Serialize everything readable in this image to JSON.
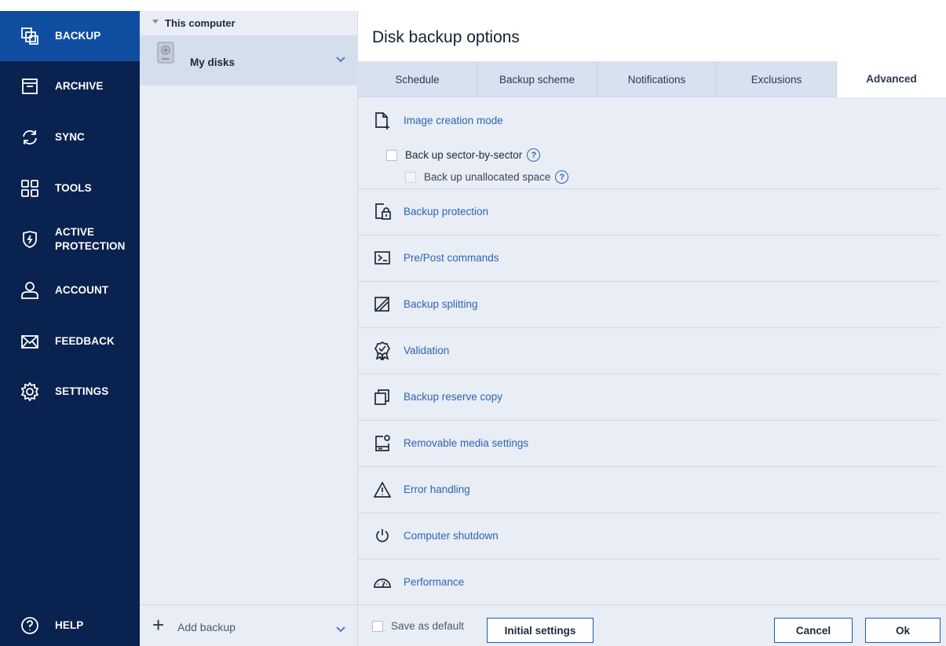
{
  "nav": {
    "items": [
      {
        "label": "BACKUP",
        "icon": "backup-icon"
      },
      {
        "label": "ARCHIVE",
        "icon": "archive-icon"
      },
      {
        "label": "SYNC",
        "icon": "sync-icon"
      },
      {
        "label": "TOOLS",
        "icon": "tools-icon"
      },
      {
        "label": "ACTIVE",
        "label2": "PROTECTION",
        "icon": "shield-icon"
      },
      {
        "label": "ACCOUNT",
        "icon": "account-icon"
      },
      {
        "label": "FEEDBACK",
        "icon": "envelope-icon"
      },
      {
        "label": "SETTINGS",
        "icon": "gear-icon"
      }
    ],
    "help": {
      "label": "HELP",
      "icon": "help-icon"
    }
  },
  "sources": {
    "group_label": "This computer",
    "selected_item": "My disks",
    "add_backup": "Add backup"
  },
  "options": {
    "title": "Disk backup options",
    "tabs": [
      "Schedule",
      "Backup scheme",
      "Notifications",
      "Exclusions",
      "Advanced"
    ],
    "active_tab": "Advanced",
    "sections": [
      {
        "label": "Image creation mode",
        "icon": "image-creation-icon",
        "expanded": true
      },
      {
        "label": "Backup protection",
        "icon": "lock-icon"
      },
      {
        "label": "Pre/Post commands",
        "icon": "terminal-icon"
      },
      {
        "label": "Backup splitting",
        "icon": "split-icon"
      },
      {
        "label": "Validation",
        "icon": "badge-icon"
      },
      {
        "label": "Backup reserve copy",
        "icon": "copy-icon"
      },
      {
        "label": "Removable media settings",
        "icon": "removable-media-icon"
      },
      {
        "label": "Error handling",
        "icon": "warning-icon"
      },
      {
        "label": "Computer shutdown",
        "icon": "power-icon"
      },
      {
        "label": "Performance",
        "icon": "gauge-icon"
      }
    ],
    "image_mode": {
      "sector_by_sector": "Back up sector-by-sector",
      "unallocated": "Back up unallocated space"
    }
  },
  "footer": {
    "save_default": "Save as default",
    "initial_settings": "Initial settings",
    "cancel": "Cancel",
    "ok": "Ok"
  },
  "colors": {
    "nav_bg": "#09224f",
    "nav_active": "#0f4da1",
    "accent_link": "#2f64b0",
    "panel_bg": "#e8edf6"
  }
}
